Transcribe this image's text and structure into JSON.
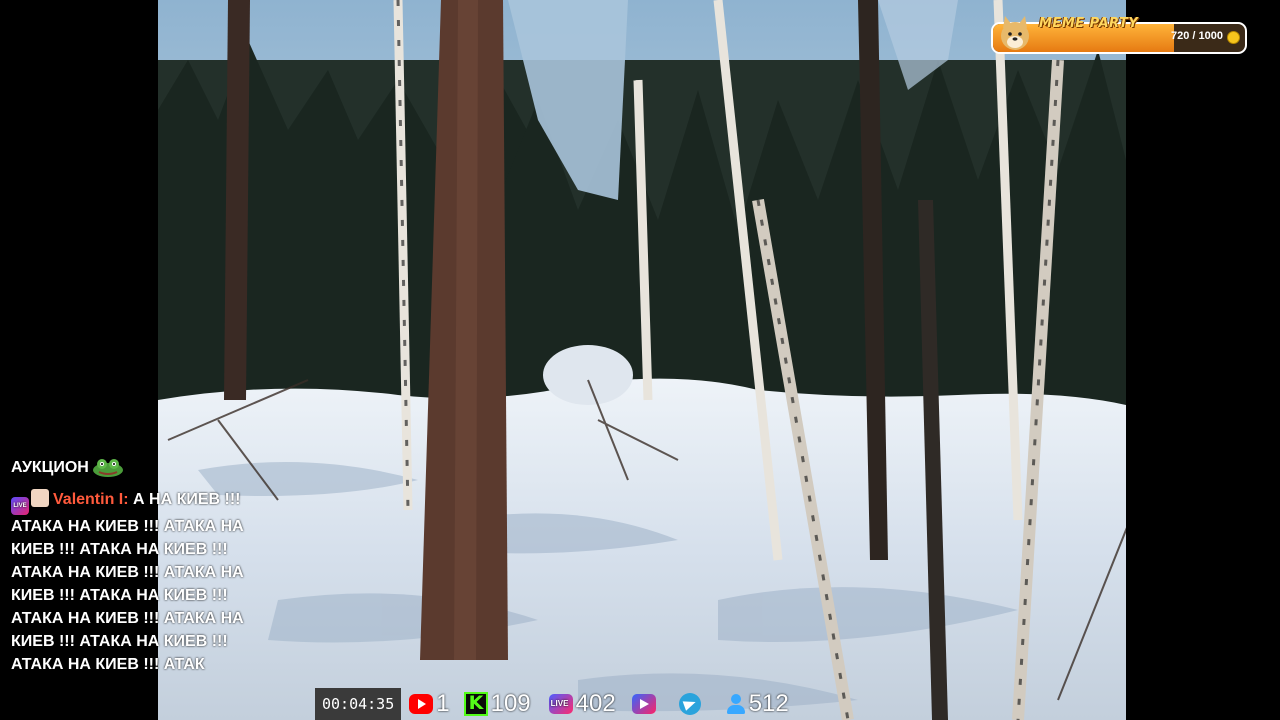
{
  "meme_party": {
    "title": "MEME PARTY",
    "progress_text": "720 / 1000",
    "progress_current": 720,
    "progress_max": 1000,
    "icon": "doge-icon",
    "coin_icon": "coin-icon",
    "accent": "#ff9d2e"
  },
  "chat": {
    "header": "АУКЦИОН",
    "header_icon": "frog-emote-icon",
    "message": {
      "badges": [
        "live-badge-icon",
        "avatar-badge-icon"
      ],
      "username": "Valentin I:",
      "username_color": "#ff5a3c",
      "text": " А НА КИЕВ !!! АТАКА НА КИЕВ !!! АТАКА НА КИЕВ !!! АТАКА НА КИЕВ !!!АТАКА НА КИЕВ !!! АТАКА НА КИЕВ !!! АТАКА НА КИЕВ !!! АТАКА НА КИЕВ !!! АТАКА НА КИЕВ !!! АТАКА НА КИЕВ !!! АТАКА НА КИЕВ !!! АТАК"
    }
  },
  "stats": {
    "timer": "00:04:35",
    "items": [
      {
        "icon": "youtube-icon",
        "value": "1"
      },
      {
        "icon": "kick-icon",
        "value": "109"
      },
      {
        "icon": "vk-live-icon",
        "value": "402"
      },
      {
        "icon": "vk-play-icon",
        "value": ""
      },
      {
        "icon": "telegram-icon",
        "value": ""
      },
      {
        "icon": "viewers-icon",
        "value": "512"
      }
    ]
  }
}
